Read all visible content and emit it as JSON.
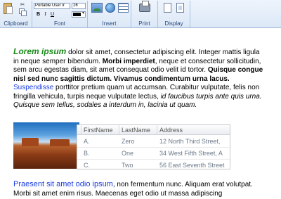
{
  "ribbon": {
    "groups": {
      "clipboard": "Clipboard",
      "font": "Font",
      "insert": "Insert",
      "print": "Print",
      "display": "Display"
    },
    "font_family": "Portable User Ir",
    "font_size": "16",
    "bold": "B",
    "italic": "I",
    "underline": "U",
    "text_color": "#000000"
  },
  "document": {
    "p1": {
      "lead": "Lorem ipsum",
      "t1": " dolor sit amet, consectetur adipiscing elit. Integer mattis ligula in neque semper bibendum. ",
      "b1": "Morbi imperdiet",
      "t2": ", neque et consectetur sollicitudin, sem arcu egestas diam, sit amet consequat odio velit id tortor. ",
      "b2": "Quisque congue nisl sed nunc sagittis dictum. Vivamus condimentum urna lacus.",
      "link": " Suspendisse",
      "t3": " porttitor pretium quam ut accumsan. Curabitur vulputate, felis non fringilla vehicula, turpis neque vulputate lectus, ",
      "i1": "id faucibus turpis ante quis urna. Quisque sem tellus, sodales a interdum in, lacinia ut quam."
    },
    "grid": {
      "columns": [
        "FirstName",
        "LastName",
        "Address"
      ],
      "rows": [
        [
          "A.",
          "Zero",
          "12 North Third Street,"
        ],
        [
          "B.",
          "One",
          "34 West Fifth Street, A"
        ],
        [
          "C.",
          "Two",
          "56 East Seventh Street"
        ]
      ]
    },
    "p2": {
      "link": "Praesent sit amet odio ipsum",
      "t1": ", non fermentum nunc. Aliquam erat volutpat. Morbi sit amet enim risus. Maecenas eget odio ut massa adipiscing"
    }
  }
}
